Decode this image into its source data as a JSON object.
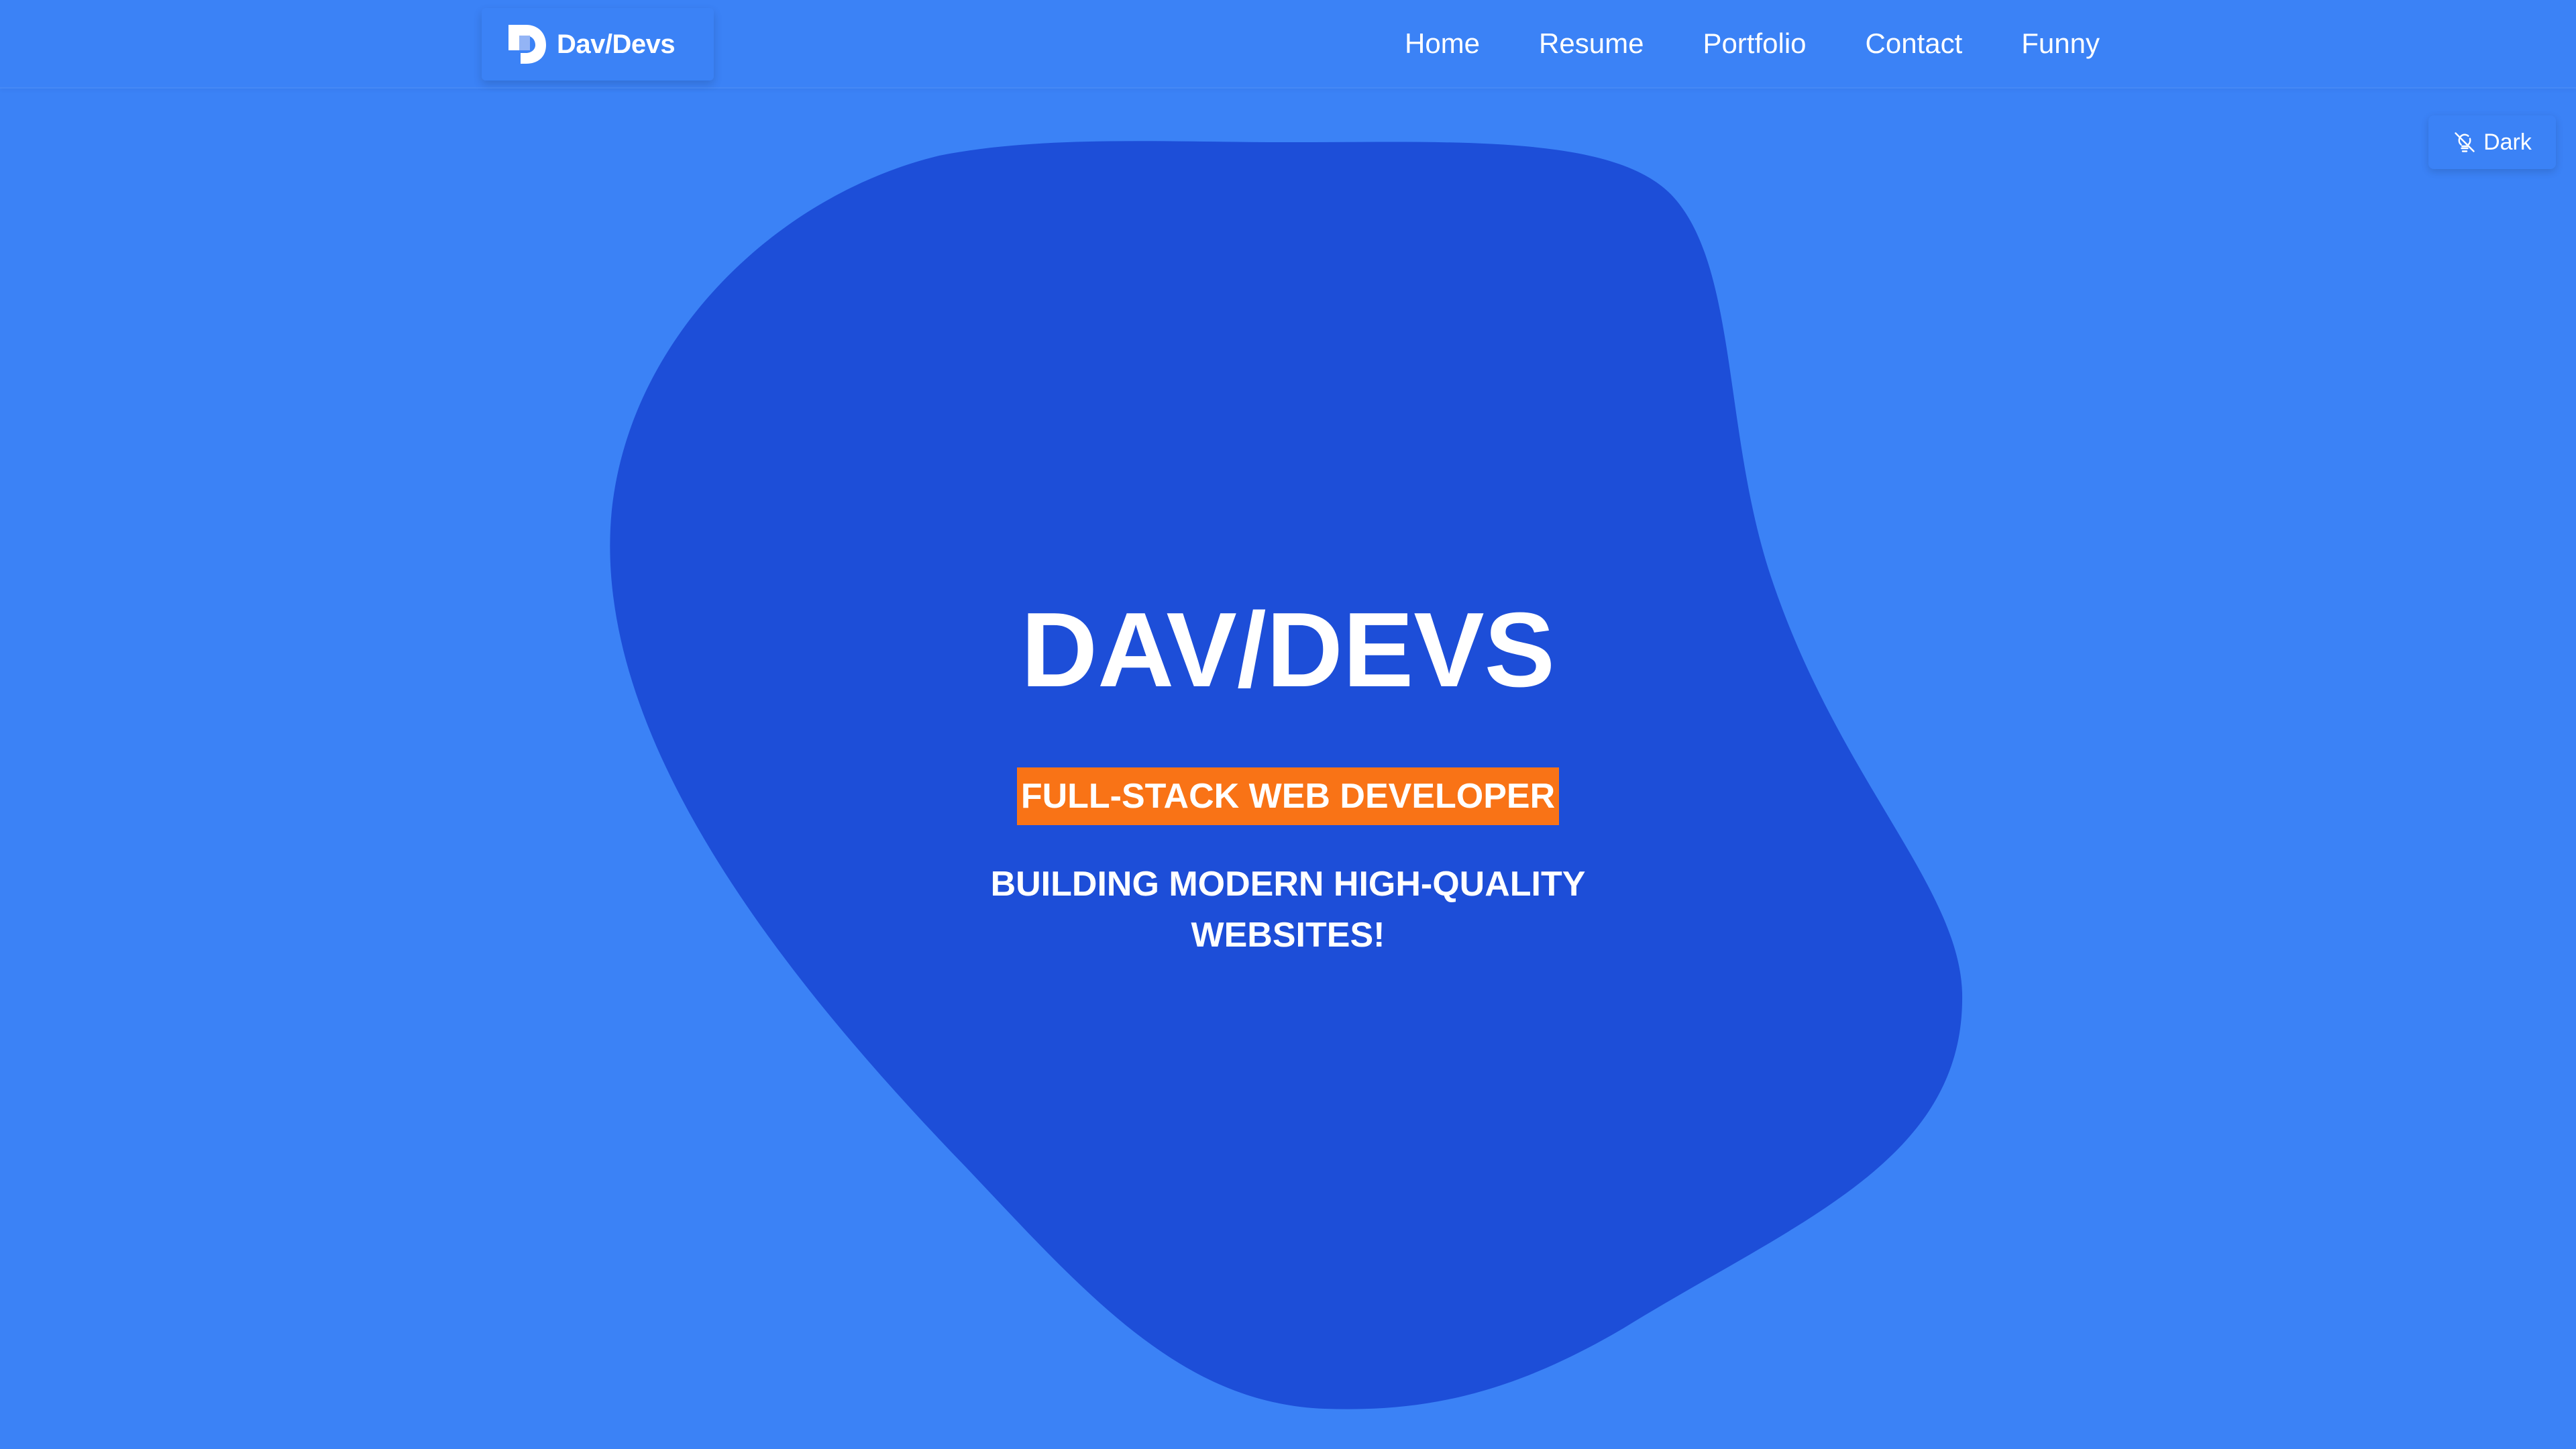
{
  "colors": {
    "background": "#3b82f6",
    "blob": "#1d4ed8",
    "badge": "#f97316",
    "text": "#ffffff"
  },
  "header": {
    "brand": {
      "logo_icon": "d-logo-icon",
      "name": "Dav/Devs"
    },
    "nav": [
      {
        "label": "Home"
      },
      {
        "label": "Resume"
      },
      {
        "label": "Portfolio"
      },
      {
        "label": "Contact"
      },
      {
        "label": "Funny"
      }
    ]
  },
  "theme_toggle": {
    "icon": "bulb-off-icon",
    "label": "Dark"
  },
  "hero": {
    "title": "DAV/DEVS",
    "badge": "FULL-STACK WEB DEVELOPER",
    "subtitle": "BUILDING MODERN HIGH-QUALITY WEBSITES!"
  }
}
